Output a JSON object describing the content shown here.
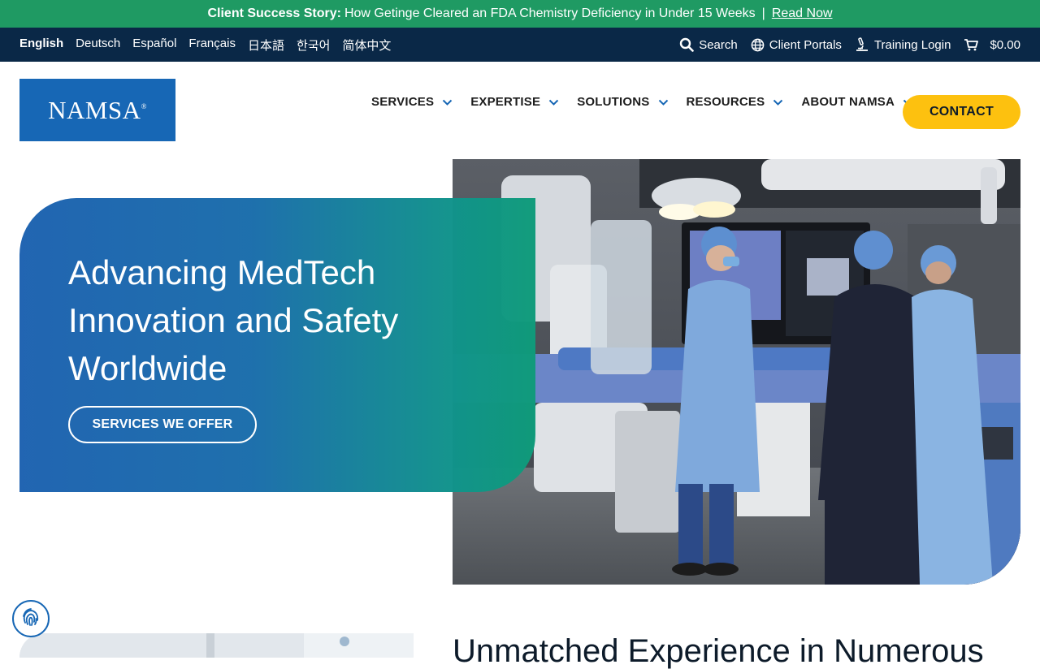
{
  "announcement": {
    "label": "Client Success Story:",
    "text": "How Getinge Cleared an FDA Chemistry Deficiency in Under 15 Weeks",
    "separator": "|",
    "link": "Read Now"
  },
  "topbar": {
    "languages": [
      "English",
      "Deutsch",
      "Español",
      "Français",
      "日本語",
      "한국어",
      "简体中文"
    ],
    "search": "Search",
    "client_portals": "Client Portals",
    "training_login": "Training Login",
    "cart_total": "$0.00"
  },
  "header": {
    "logo_text": "NAMSA",
    "logo_mark": "®",
    "nav": [
      "SERVICES",
      "EXPERTISE",
      "SOLUTIONS",
      "RESOURCES",
      "ABOUT NAMSA"
    ],
    "contact": "CONTACT"
  },
  "hero": {
    "title_line1": "Advancing MedTech",
    "title_line2": "Innovation and Safety",
    "title_line3": "Worldwide",
    "button": "SERVICES WE OFFER"
  },
  "section": {
    "title": "Unmatched Experience in Numerous"
  },
  "icons": {
    "search": "search-icon",
    "globe": "globe-icon",
    "training": "microscope-icon",
    "cart": "cart-icon",
    "chevron": "chevron-down-icon",
    "fingerprint": "fingerprint-icon"
  },
  "colors": {
    "announce_bg": "#1f9a63",
    "topbar_bg": "#0a2847",
    "brand_blue": "#1767b5",
    "cta_yellow": "#fdc10f"
  }
}
